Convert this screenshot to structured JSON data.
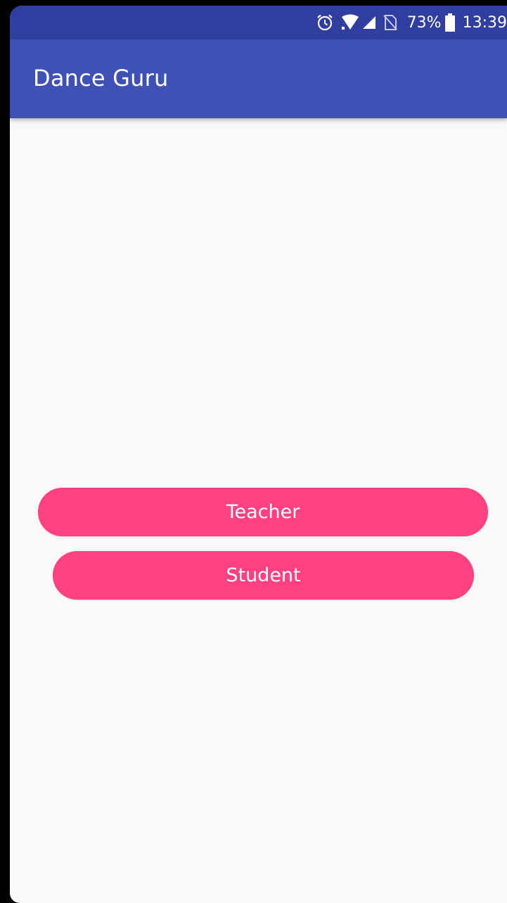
{
  "status_bar": {
    "battery_percent": "73%",
    "time": "13:39",
    "icons": [
      "alarm-icon",
      "wifi-icon",
      "signal-icon",
      "no-sim-icon",
      "battery-icon"
    ]
  },
  "app_bar": {
    "title": "Dance Guru"
  },
  "main": {
    "teacher_label": "Teacher",
    "student_label": "Student"
  },
  "colors": {
    "status_bar": "#303f9f",
    "app_bar": "#3f51b5",
    "accent": "#ff4081",
    "background": "#f9f9f9"
  }
}
